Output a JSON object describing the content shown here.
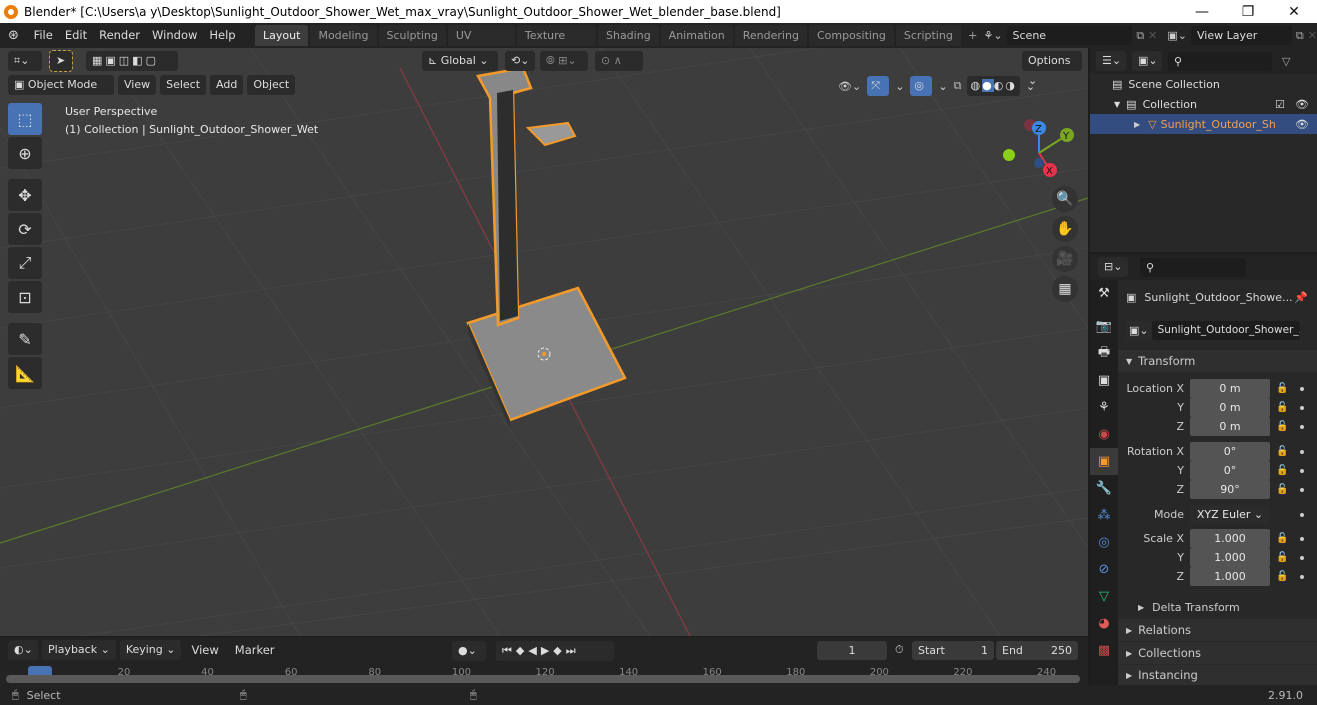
{
  "window": {
    "title": "Blender* [C:\\Users\\a y\\Desktop\\Sunlight_Outdoor_Shower_Wet_max_vray\\Sunlight_Outdoor_Shower_Wet_blender_base.blend]",
    "minimize": "—",
    "maximize": "❐",
    "close": "✕"
  },
  "menu": [
    "File",
    "Edit",
    "Render",
    "Window",
    "Help"
  ],
  "workspaces": [
    {
      "label": "Layout",
      "active": true
    },
    {
      "label": "Modeling"
    },
    {
      "label": "Sculpting"
    },
    {
      "label": "UV Editing"
    },
    {
      "label": "Texture Paint"
    },
    {
      "label": "Shading"
    },
    {
      "label": "Animation"
    },
    {
      "label": "Rendering"
    },
    {
      "label": "Compositing"
    },
    {
      "label": "Scripting"
    }
  ],
  "add_workspace": "+",
  "scene": {
    "label": "Scene"
  },
  "view_layer": {
    "label": "View Layer"
  },
  "viewport": {
    "transform_orientation": "Global",
    "options": "Options",
    "mode": "Object Mode",
    "header_menus": [
      "View",
      "Select",
      "Add",
      "Object"
    ],
    "overlay_title": "User Perspective",
    "overlay_subtitle": "(1) Collection | Sunlight_Outdoor_Shower_Wet",
    "gizmo": {
      "x": "X",
      "y": "Y",
      "z": "Z",
      "x_color": "#e5344b",
      "y_color": "#7aa621",
      "z_color": "#3b87e6"
    },
    "tools": [
      "select-box",
      "cursor",
      "move",
      "rotate",
      "scale",
      "transform",
      "annotate",
      "measure"
    ]
  },
  "outliner": {
    "scene_collection": "Scene Collection",
    "collection": "Collection",
    "object": "Sunlight_Outdoor_Sh"
  },
  "properties": {
    "object_name": "Sunlight_Outdoor_Showe...",
    "data_name": "Sunlight_Outdoor_Shower_...",
    "transform": "Transform",
    "location_label": "Location X",
    "rotation_label": "Rotation X",
    "scale_label": "Scale X",
    "y_label": "Y",
    "z_label": "Z",
    "location": [
      "0 m",
      "0 m",
      "0 m"
    ],
    "rotation": [
      "0°",
      "0°",
      "90°"
    ],
    "mode_label": "Mode",
    "mode_value": "XYZ Euler",
    "scale": [
      "1.000",
      "1.000",
      "1.000"
    ],
    "delta_transform": "Delta Transform",
    "relations": "Relations",
    "collections": "Collections",
    "instancing": "Instancing"
  },
  "timeline": {
    "menus": [
      "Playback",
      "Keying",
      "View",
      "Marker"
    ],
    "current_frame": "1",
    "start_label": "Start",
    "start": "1",
    "end_label": "End",
    "end": "250",
    "ticks": [
      "1",
      "20",
      "40",
      "60",
      "80",
      "100",
      "120",
      "140",
      "160",
      "180",
      "200",
      "220",
      "240"
    ]
  },
  "status": {
    "select": "Select",
    "version": "2.91.0"
  }
}
